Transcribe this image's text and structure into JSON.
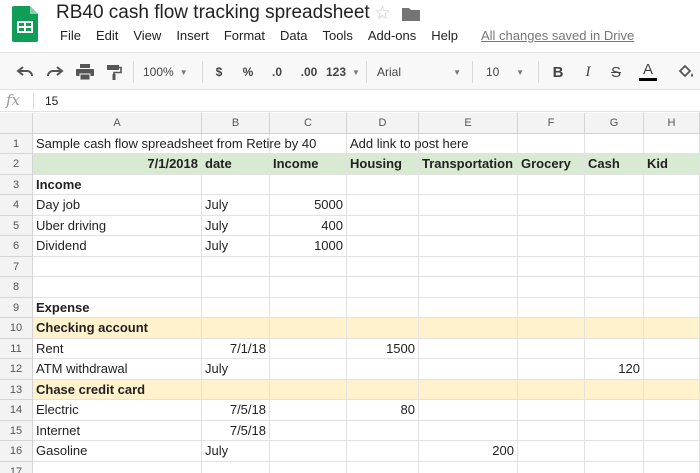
{
  "header": {
    "title": "RB40 cash flow tracking spreadsheet",
    "menu": [
      "File",
      "Edit",
      "View",
      "Insert",
      "Format",
      "Data",
      "Tools",
      "Add-ons",
      "Help"
    ],
    "saved_status": "All changes saved in Drive"
  },
  "toolbar": {
    "zoom": "100%",
    "currency": "$",
    "percent": "%",
    "decimal_decrease": ".0",
    "decimal_increase": ".00",
    "more_formats": "123",
    "font": "Arial",
    "font_size": "10",
    "bold": "B",
    "italic": "I",
    "strikethrough": "S",
    "text_color": "A"
  },
  "formula_bar": {
    "fx_label": "fx",
    "value": "15"
  },
  "columns": [
    "A",
    "B",
    "C",
    "D",
    "E",
    "F",
    "G",
    "H"
  ],
  "rows": [
    {
      "num": "1",
      "cells": [
        "Sample cash flow spreadsheet from Retire by 40",
        "",
        "",
        "Add link to post here",
        "",
        "",
        "",
        ""
      ]
    },
    {
      "num": "2",
      "cells": [
        "7/1/2018",
        "date",
        "Income",
        "Housing",
        "Transportation",
        "Grocery",
        "Cash",
        "Kid"
      ]
    },
    {
      "num": "3",
      "cells": [
        "Income",
        "",
        "",
        "",
        "",
        "",
        "",
        ""
      ]
    },
    {
      "num": "4",
      "cells": [
        "Day job",
        "July",
        "5000",
        "",
        "",
        "",
        "",
        ""
      ]
    },
    {
      "num": "5",
      "cells": [
        "Uber driving",
        "July",
        "400",
        "",
        "",
        "",
        "",
        ""
      ]
    },
    {
      "num": "6",
      "cells": [
        "Dividend",
        "July",
        "1000",
        "",
        "",
        "",
        "",
        ""
      ]
    },
    {
      "num": "7",
      "cells": [
        "",
        "",
        "",
        "",
        "",
        "",
        "",
        ""
      ]
    },
    {
      "num": "8",
      "cells": [
        "",
        "",
        "",
        "",
        "",
        "",
        "",
        ""
      ]
    },
    {
      "num": "9",
      "cells": [
        "Expense",
        "",
        "",
        "",
        "",
        "",
        "",
        ""
      ]
    },
    {
      "num": "10",
      "cells": [
        "Checking account",
        "",
        "",
        "",
        "",
        "",
        "",
        ""
      ]
    },
    {
      "num": "11",
      "cells": [
        "Rent",
        "7/1/18",
        "",
        "1500",
        "",
        "",
        "",
        ""
      ]
    },
    {
      "num": "12",
      "cells": [
        "ATM withdrawal",
        "July",
        "",
        "",
        "",
        "",
        "120",
        ""
      ]
    },
    {
      "num": "13",
      "cells": [
        "Chase credit card",
        "",
        "",
        "",
        "",
        "",
        "",
        ""
      ]
    },
    {
      "num": "14",
      "cells": [
        "Electric",
        "7/5/18",
        "",
        "80",
        "",
        "",
        "",
        ""
      ]
    },
    {
      "num": "15",
      "cells": [
        "Internet",
        "7/5/18",
        "",
        "",
        "",
        "",
        "",
        ""
      ]
    },
    {
      "num": "16",
      "cells": [
        "Gasoline",
        "July",
        "",
        "",
        "200",
        "",
        "",
        ""
      ]
    },
    {
      "num": "17",
      "cells": [
        "",
        "",
        "",
        "",
        "",
        "",
        "",
        ""
      ]
    }
  ],
  "colors": {
    "header_green": "#d9ead3",
    "section_yellow": "#fff2cc",
    "sheets_green": "#0f9d58"
  }
}
